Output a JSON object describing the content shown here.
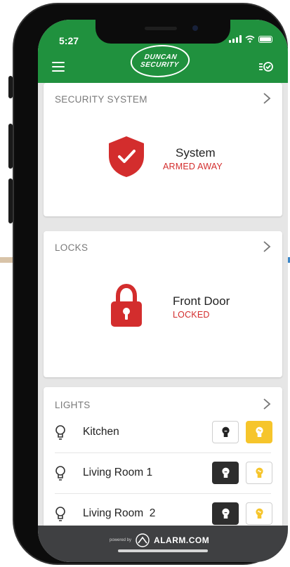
{
  "status_bar": {
    "time": "5:27"
  },
  "header": {
    "logo_line1": "DUNCAN",
    "logo_line2": "SECURITY"
  },
  "security": {
    "title": "SECURITY SYSTEM",
    "device_name": "System",
    "device_status": "ARMED AWAY"
  },
  "locks": {
    "title": "LOCKS",
    "device_name": "Front Door",
    "device_status": "LOCKED"
  },
  "lights": {
    "title": "LIGHTS",
    "items": [
      {
        "label": "Kitchen",
        "state": "on"
      },
      {
        "label": "Living Room 1",
        "state": "off"
      },
      {
        "label": "Living Room  2",
        "state": "off"
      }
    ]
  },
  "footer": {
    "powered_by": "powered by",
    "brand": "ALARM.COM"
  },
  "colors": {
    "header_green": "#20913e",
    "alert_red": "#d32d2d",
    "light_on_yellow": "#f6c52b",
    "footer_gray": "#3f4042"
  },
  "icons": [
    "menu-icon",
    "checklist-icon",
    "shield-check-icon",
    "padlock-icon",
    "chevron-right-icon",
    "bulb-icon",
    "light-off-icon",
    "light-on-icon",
    "alarm-logo-icon"
  ]
}
